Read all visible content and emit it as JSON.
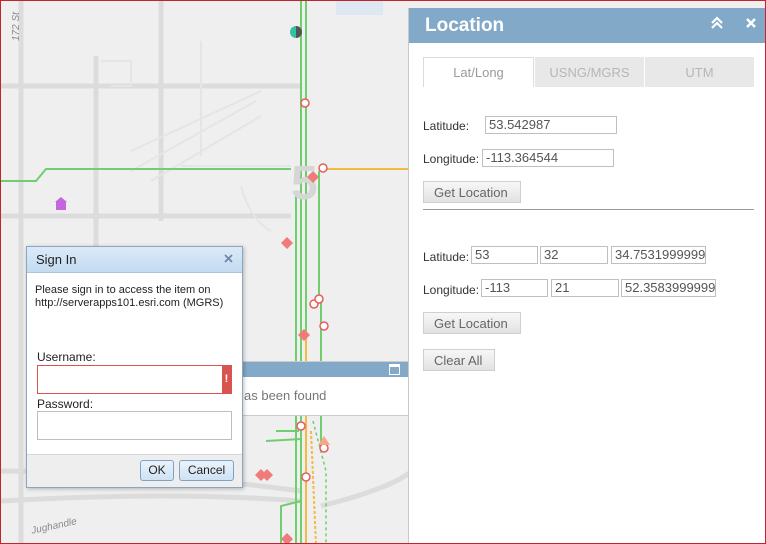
{
  "map": {
    "street_labels": [
      "172 St",
      "Jughandle"
    ],
    "route_number": "5"
  },
  "location_panel": {
    "title": "Location",
    "collapse_icon": "double-chevron-up-icon",
    "close_icon": "close-icon",
    "tabs": [
      {
        "label": "Lat/Long",
        "active": true
      },
      {
        "label": "USNG/MGRS",
        "active": false
      },
      {
        "label": "UTM",
        "active": false
      }
    ],
    "decimal": {
      "latitude_label": "Latitude:",
      "latitude_value": "53.542987",
      "longitude_label": "Longitude:",
      "longitude_value": "-113.364544",
      "get_location_label": "Get Location"
    },
    "dms": {
      "latitude_label": "Latitude:",
      "lat_deg": "53",
      "lat_min": "32",
      "lat_sec": "34.7531999999",
      "longitude_label": "Longitude:",
      "lon_deg": "-113",
      "lon_min": "21",
      "lon_sec": "52.3583999999",
      "get_location_label": "Get Location",
      "clear_all_label": "Clear All"
    }
  },
  "popup": {
    "text": "as been found"
  },
  "signin": {
    "title": "Sign In",
    "message": "Please sign in to access the item on http://serverapps101.esri.com (MGRS)",
    "username_label": "Username:",
    "username_value": "",
    "error_icon": "!",
    "password_label": "Password:",
    "password_value": "",
    "ok_label": "OK",
    "cancel_label": "Cancel"
  },
  "colors": {
    "header_blue": "#82a9c7",
    "route_green": "#5cc85c",
    "road_orange": "#f4b942",
    "marker_red": "#f07b7b"
  }
}
